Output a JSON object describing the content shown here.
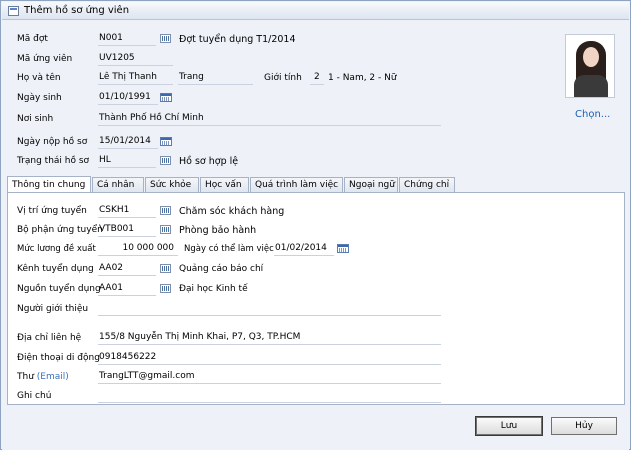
{
  "window": {
    "title": "Thêm hồ sơ ứng viên"
  },
  "header": {
    "ma_dot": {
      "label": "Mã đợt",
      "value": "N001",
      "desc": "Đợt tuyển dụng T1/2014"
    },
    "ma_ung_vien": {
      "label": "Mã ứng viên",
      "value": "UV1205"
    },
    "ho_ten": {
      "label": "Họ và tên",
      "ho": "Lê Thị Thanh",
      "ten": "Trang"
    },
    "gioi_tinh": {
      "label": "Giới tính",
      "value": "2",
      "hint": "1 - Nam, 2 - Nữ"
    },
    "ngay_sinh": {
      "label": "Ngày sinh",
      "value": "01/10/1991"
    },
    "noi_sinh": {
      "label": "Nơi sinh",
      "value": "Thành Phố Hồ Chí Minh"
    },
    "ngay_nop": {
      "label": "Ngày nộp hồ sơ",
      "value": "15/01/2014"
    },
    "trang_thai": {
      "label": "Trạng thái hồ sơ",
      "value": "HL",
      "desc": "Hồ sơ hợp lệ"
    },
    "photo_button": "Chọn..."
  },
  "tabs": [
    "Thông tin chung",
    "Cá nhân",
    "Sức khỏe",
    "Học vấn",
    "Quá trình làm việc",
    "Ngoại ngữ",
    "Chứng chỉ"
  ],
  "general": {
    "vi_tri": {
      "label": "Vị trí ứng tuyển",
      "value": "CSKH1",
      "desc": "Chăm sóc khách hàng"
    },
    "bo_phan": {
      "label": "Bộ phận ứng tuyển",
      "value": "VTB001",
      "desc": "Phòng bảo hành"
    },
    "muc_luong": {
      "label": "Mức lương đề xuất",
      "value": "10 000 000"
    },
    "ngay_lam": {
      "label": "Ngày có thể làm việc",
      "value": "01/02/2014"
    },
    "kenh": {
      "label": "Kênh tuyển dụng",
      "value": "AA02",
      "desc": "Quảng cáo báo chí"
    },
    "nguon": {
      "label": "Nguồn tuyển dụng",
      "value": "AA01",
      "desc": "Đại học Kinh tế"
    },
    "gioi_thieu": {
      "label": "Người giới thiệu",
      "value": ""
    },
    "dia_chi": {
      "label": "Địa chỉ liên hệ",
      "value": "155/8 Nguyễn Thị Minh Khai, P7, Q3, TP.HCM"
    },
    "dien_thoai": {
      "label": "Điện thoại di động",
      "value": "0918456222"
    },
    "thu": {
      "label": "Thư",
      "label_suffix": "(Email)",
      "value": "TrangLTT@gmail.com"
    },
    "ghi_chu": {
      "label": "Ghi chú",
      "value": ""
    }
  },
  "footer": {
    "save": "Lưu",
    "cancel": "Hủy"
  }
}
